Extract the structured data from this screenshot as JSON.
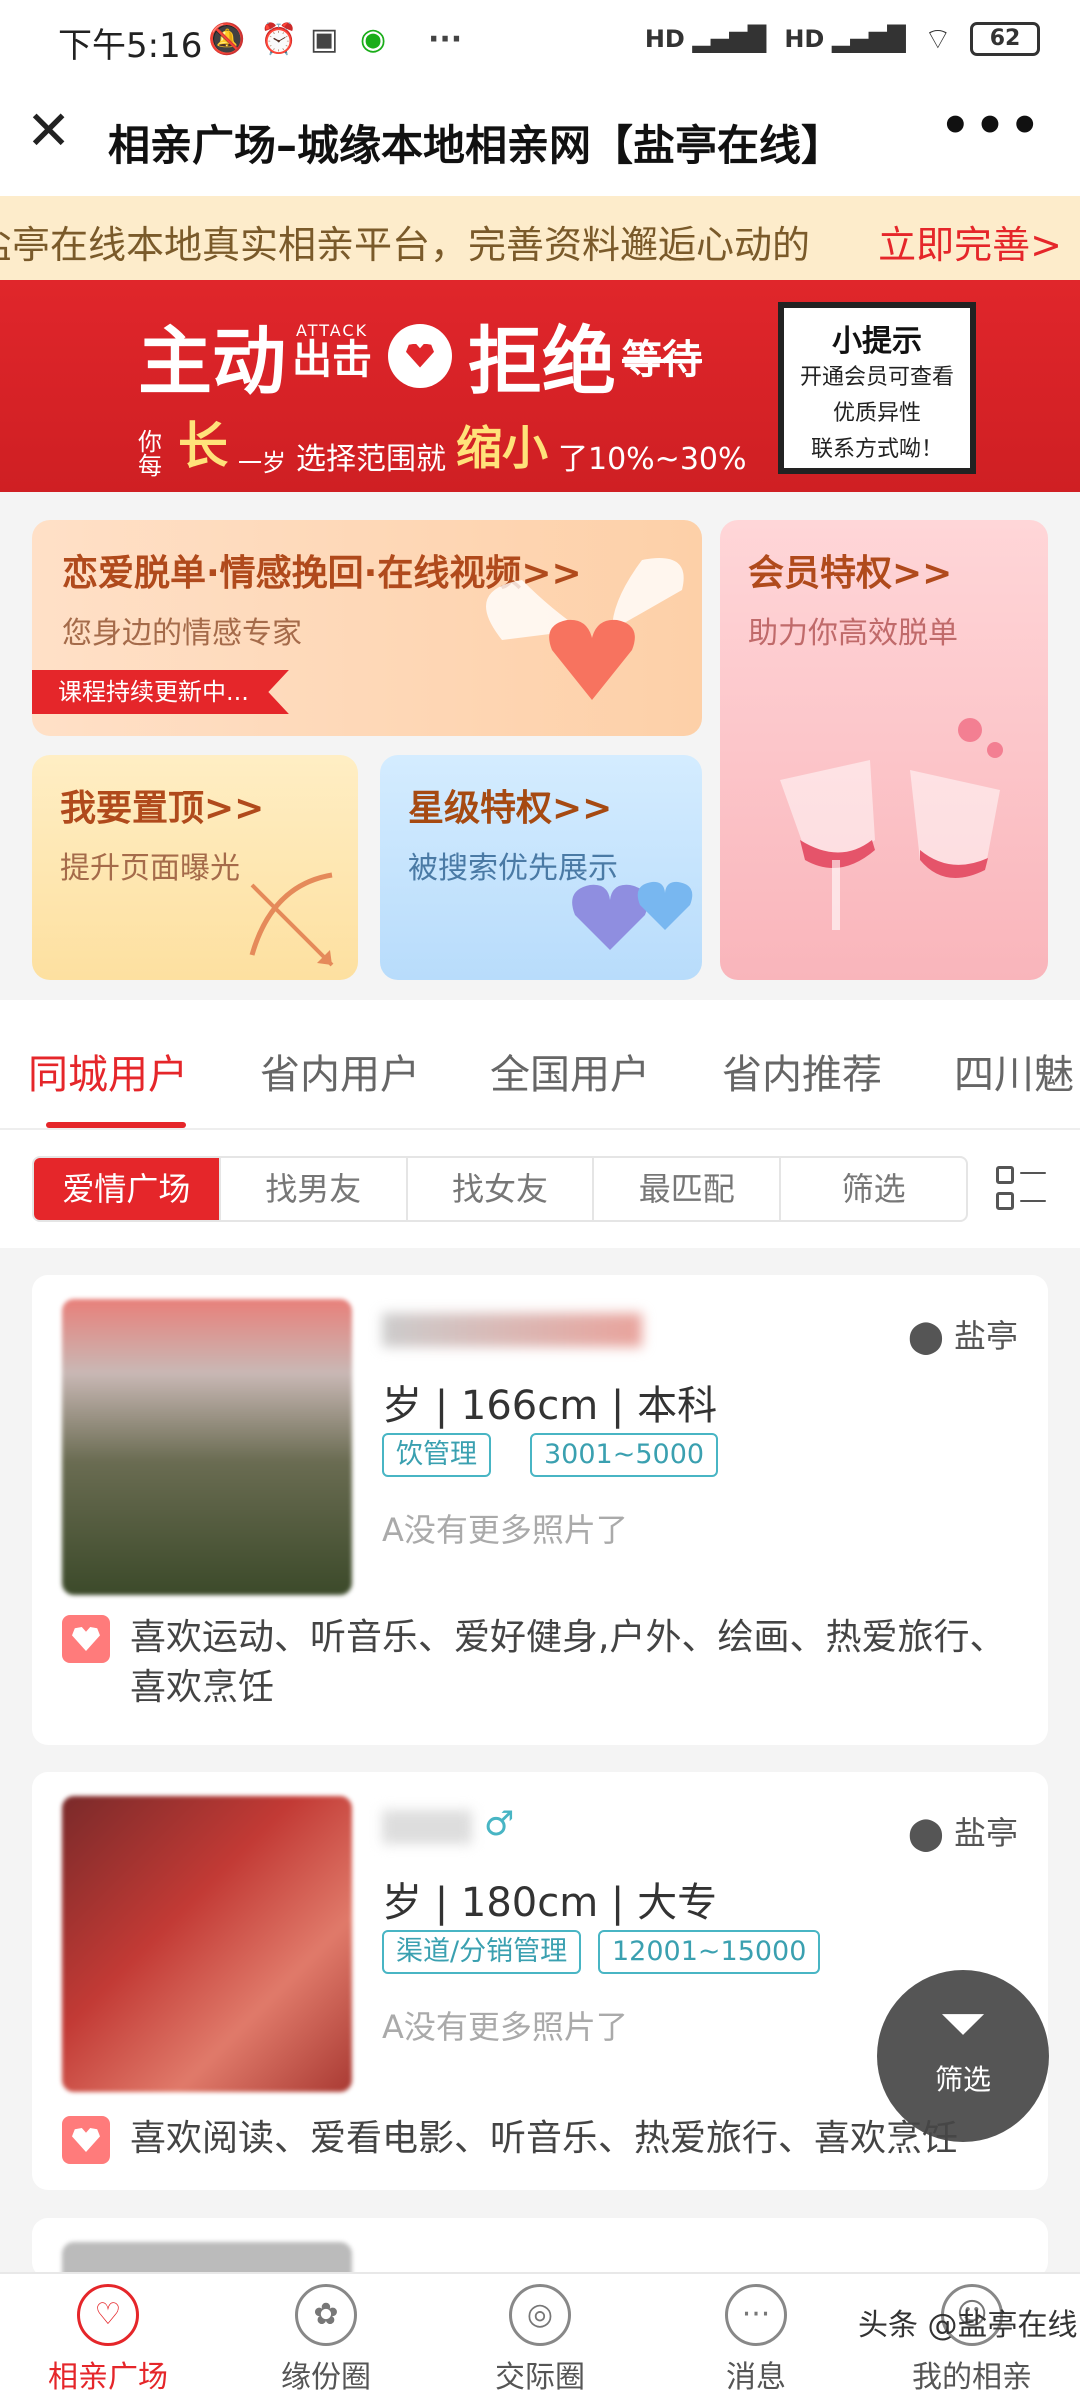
{
  "status_bar": {
    "time": "下午5:16",
    "battery": "62",
    "network_1": "HD",
    "network_2": "HD"
  },
  "titlebar": {
    "title": "相亲广场–城缘本地相亲网【盐亭在线】"
  },
  "notice": {
    "text": "盐亭在线本地真实相亲平台，完善资料邂逅心动的",
    "link": "立即完善>"
  },
  "banner": {
    "line1_a": "主动",
    "line1_b": "出击",
    "attack": "ATTACK",
    "line1_c": "拒绝",
    "line1_d": "等待",
    "line2_a": "你每",
    "line2_b": "长",
    "line2_c": "一岁",
    "line2_d": "选择范围就",
    "line2_e": "缩小",
    "line2_f": "了10%~30%",
    "tip_title": "小提示",
    "tip_body": [
      "开通会员可查看",
      "优质异性",
      "联系方式呦！"
    ]
  },
  "cards": [
    {
      "title": "恋爱脱单·情感挽回·在线视频>>",
      "subtitle": "您身边的情感专家",
      "tag": "课程持续更新中..."
    },
    {
      "title": "会员特权>>",
      "subtitle": "助力你高效脱单"
    },
    {
      "title": "我要置顶>>",
      "subtitle": "提升页面曝光"
    },
    {
      "title": "星级特权>>",
      "subtitle": "被搜索优先展示"
    }
  ],
  "tabs": [
    "同城用户",
    "省内用户",
    "全国用户",
    "省内推荐",
    "四川魅"
  ],
  "segments": [
    "爱情广场",
    "找男友",
    "找女友",
    "最匹配",
    "筛选"
  ],
  "profiles": [
    {
      "location": "盐亭",
      "meta": "岁 | 166cm | 本科",
      "job": "饮管理",
      "income": "3001~5000",
      "no_more": "A没有更多照片了",
      "interests": "喜欢运动、听音乐、爱好健身,户外、绘画、热爱旅行、喜欢烹饪"
    },
    {
      "location": "盐亭",
      "meta": "岁 | 180cm | 大专",
      "job": "渠道/分销管理",
      "income": "12001~15000",
      "no_more": "A没有更多照片了",
      "interests": "喜欢阅读、爱看电影、听音乐、热爱旅行、喜欢烹饪"
    }
  ],
  "fab": {
    "label": "筛选"
  },
  "nav": [
    "相亲广场",
    "缘份圈",
    "交际圈",
    "消息",
    "我的相亲"
  ],
  "watermark": "头条 @盐亭在线"
}
